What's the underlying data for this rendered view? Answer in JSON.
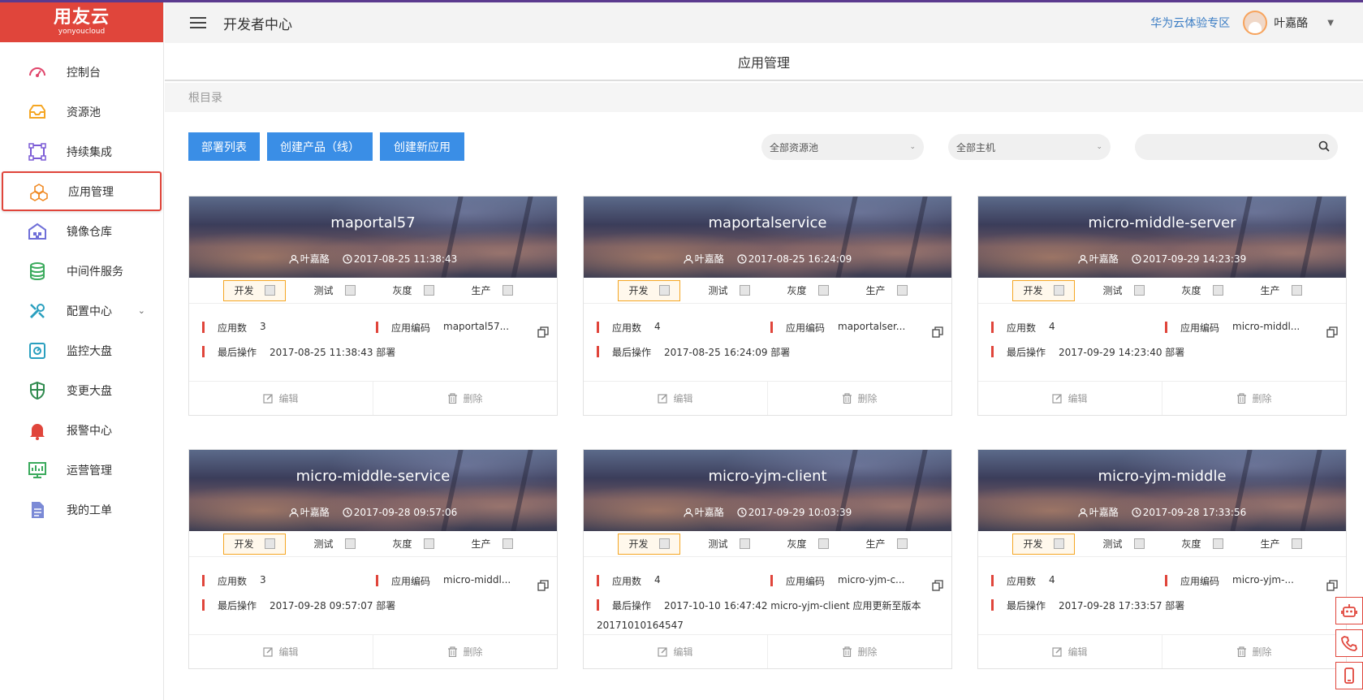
{
  "logo": {
    "main": "用友云",
    "sub": "yonyoucloud"
  },
  "header": {
    "title": "开发者中心",
    "huawei_link": "华为云体验专区",
    "username": "叶嘉酪"
  },
  "sidebar": {
    "items": [
      {
        "label": "控制台",
        "icon": "dashboard-icon"
      },
      {
        "label": "资源池",
        "icon": "inbox-icon"
      },
      {
        "label": "持续集成",
        "icon": "integration-icon"
      },
      {
        "label": "应用管理",
        "icon": "cubes-icon",
        "active": true
      },
      {
        "label": "镜像仓库",
        "icon": "warehouse-icon"
      },
      {
        "label": "中间件服务",
        "icon": "database-icon"
      },
      {
        "label": "配置中心",
        "icon": "tools-icon",
        "expandable": true
      },
      {
        "label": "监控大盘",
        "icon": "monitor-icon"
      },
      {
        "label": "变更大盘",
        "icon": "shield-icon"
      },
      {
        "label": "报警中心",
        "icon": "bell-icon"
      },
      {
        "label": "运营管理",
        "icon": "chart-screen-icon"
      },
      {
        "label": "我的工单",
        "icon": "document-icon"
      }
    ]
  },
  "page": {
    "title": "应用管理",
    "breadcrumb": "根目录"
  },
  "toolbar": {
    "deploy_list": "部署列表",
    "create_product": "创建产品（线）",
    "create_app": "创建新应用",
    "resource_pool_select": "全部资源池",
    "host_select": "全部主机",
    "search_placeholder": ""
  },
  "labels": {
    "env_dev": "开发",
    "env_test": "测试",
    "env_gray": "灰度",
    "env_prod": "生产",
    "app_count": "应用数",
    "app_code": "应用编码",
    "last_op": "最后操作",
    "edit": "编辑",
    "delete": "删除"
  },
  "cards": [
    {
      "name": "maportal57",
      "owner": "叶嘉酪",
      "time": "2017-08-25 11:38:43",
      "count": "3",
      "code": "maportal57...",
      "last_op": "2017-08-25 11:38:43 部署",
      "last_op_wrap": ""
    },
    {
      "name": "maportalservice",
      "owner": "叶嘉酪",
      "time": "2017-08-25 16:24:09",
      "count": "4",
      "code": "maportalser...",
      "last_op": "2017-08-25 16:24:09 部署",
      "last_op_wrap": ""
    },
    {
      "name": "micro-middle-server",
      "owner": "叶嘉酪",
      "time": "2017-09-29 14:23:39",
      "count": "4",
      "code": "micro-middl...",
      "last_op": "2017-09-29 14:23:40 部署",
      "last_op_wrap": ""
    },
    {
      "name": "micro-middle-service",
      "owner": "叶嘉酪",
      "time": "2017-09-28 09:57:06",
      "count": "3",
      "code": "micro-middl...",
      "last_op": "2017-09-28 09:57:07 部署",
      "last_op_wrap": ""
    },
    {
      "name": "micro-yjm-client",
      "owner": "叶嘉酪",
      "time": "2017-09-29 10:03:39",
      "count": "4",
      "code": "micro-yjm-c...",
      "last_op": "2017-10-10 16:47:42 micro-yjm-client 应用更新至版本",
      "last_op_wrap": "20171010164547"
    },
    {
      "name": "micro-yjm-middle",
      "owner": "叶嘉酪",
      "time": "2017-09-28 17:33:56",
      "count": "4",
      "code": "micro-yjm-...",
      "last_op": "2017-09-28 17:33:57 部署",
      "last_op_wrap": ""
    }
  ],
  "floating": [
    {
      "icon": "robot-icon"
    },
    {
      "icon": "phone-icon"
    },
    {
      "icon": "mobile-icon"
    }
  ],
  "colors": {
    "brand": "#e0453b",
    "primary": "#3a8ee6",
    "link": "#3b7dc4",
    "env_active": "#f5a623"
  }
}
